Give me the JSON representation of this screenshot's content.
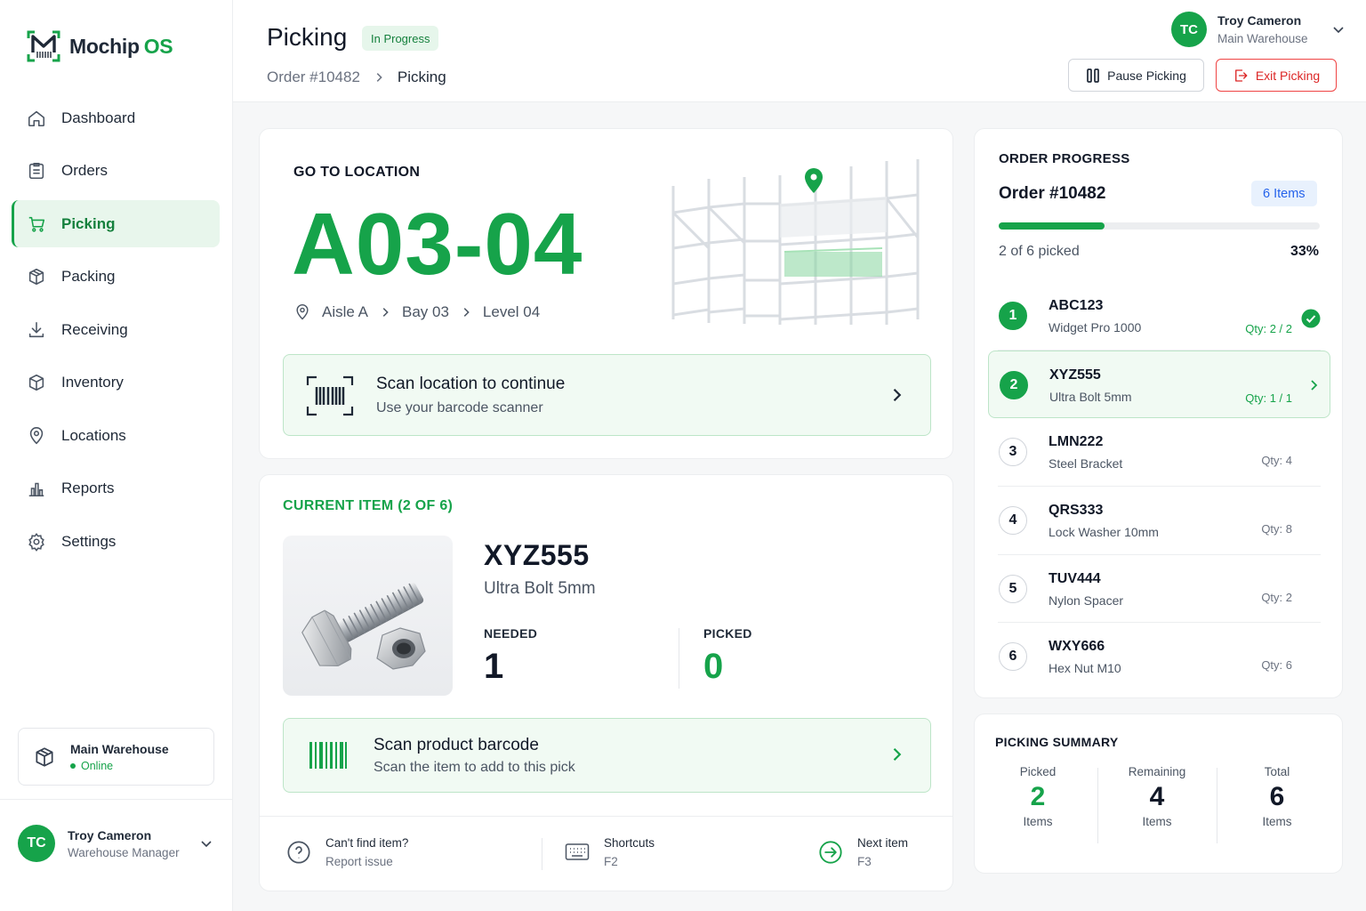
{
  "app": {
    "brand_main": "Mochip",
    "brand_accent": "OS"
  },
  "colors": {
    "accent": "#16a34a",
    "danger": "#dc2626",
    "info": "#2563eb"
  },
  "sidebar": {
    "items": [
      {
        "label": "Dashboard",
        "icon": "home-icon",
        "active": false
      },
      {
        "label": "Orders",
        "icon": "clipboard-icon",
        "active": false
      },
      {
        "label": "Picking",
        "icon": "cart-icon",
        "active": true
      },
      {
        "label": "Packing",
        "icon": "box-icon",
        "active": false
      },
      {
        "label": "Receiving",
        "icon": "download-icon",
        "active": false
      },
      {
        "label": "Inventory",
        "icon": "cube-icon",
        "active": false
      },
      {
        "label": "Locations",
        "icon": "pin-icon",
        "active": false
      },
      {
        "label": "Reports",
        "icon": "bar-chart-icon",
        "active": false
      },
      {
        "label": "Settings",
        "icon": "gear-icon",
        "active": false
      }
    ],
    "warehouse": {
      "name": "Main Warehouse",
      "status": "Online"
    },
    "user": {
      "initials": "TC",
      "name": "Troy Cameron",
      "role": "Warehouse Manager"
    }
  },
  "header": {
    "title": "Picking",
    "status_badge": "In Progress",
    "breadcrumb": [
      "Order #10482",
      "Picking"
    ],
    "user": {
      "initials": "TC",
      "name": "Troy Cameron",
      "warehouse": "Main Warehouse"
    },
    "pause_label": "Pause Picking",
    "exit_label": "Exit Picking"
  },
  "location": {
    "label": "GO TO LOCATION",
    "code": "A03-04",
    "aisle": "Aisle A",
    "bay": "Bay 03",
    "level": "Level 04",
    "scan_title": "Scan location to continue",
    "scan_sub": "Use your barcode scanner"
  },
  "current_item": {
    "label": "CURRENT ITEM (2 OF 6)",
    "sku": "XYZ555",
    "name": "Ultra Bolt 5mm",
    "needed_label": "NEEDED",
    "needed": "1",
    "picked_label": "PICKED",
    "picked": "0",
    "scan_title": "Scan product barcode",
    "scan_sub": "Scan the item to add to this pick",
    "footer": {
      "cant_find_title": "Can't find item?",
      "cant_find_sub": "Report issue",
      "shortcuts_title": "Shortcuts",
      "shortcuts_key": "F2",
      "next_title": "Next item",
      "next_key": "F3"
    }
  },
  "order_progress": {
    "label": "ORDER PROGRESS",
    "order": "Order #10482",
    "items_badge": "6 Items",
    "picked_text": "2 of 6 picked",
    "percent_text": "33%",
    "progress_fraction": 0.33,
    "lines": [
      {
        "num": "1",
        "sku": "ABC123",
        "name": "Widget Pro 1000",
        "qty": "Qty: 2 / 2",
        "state": "done"
      },
      {
        "num": "2",
        "sku": "XYZ555",
        "name": "Ultra Bolt 5mm",
        "qty": "Qty: 1 / 1",
        "state": "active"
      },
      {
        "num": "3",
        "sku": "LMN222",
        "name": "Steel Bracket",
        "qty": "Qty: 4",
        "state": "pending"
      },
      {
        "num": "4",
        "sku": "QRS333",
        "name": "Lock Washer 10mm",
        "qty": "Qty: 8",
        "state": "pending"
      },
      {
        "num": "5",
        "sku": "TUV444",
        "name": "Nylon Spacer",
        "qty": "Qty: 2",
        "state": "pending"
      },
      {
        "num": "6",
        "sku": "WXY666",
        "name": "Hex Nut M10",
        "qty": "Qty: 6",
        "state": "pending"
      }
    ]
  },
  "summary": {
    "label": "PICKING SUMMARY",
    "picked_label": "Picked",
    "picked": "2",
    "picked_unit": "Items",
    "remaining_label": "Remaining",
    "remaining": "4",
    "remaining_unit": "Items",
    "total_label": "Total",
    "total": "6",
    "total_unit": "Items"
  }
}
